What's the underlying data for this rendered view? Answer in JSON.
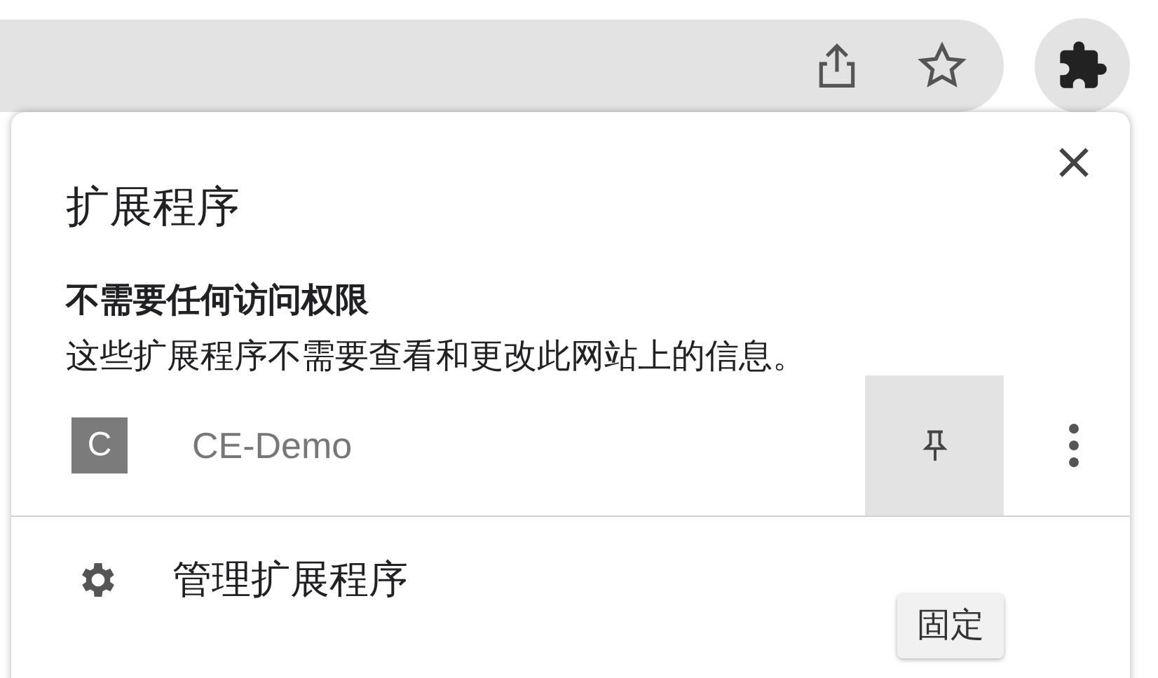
{
  "popup": {
    "title": "扩展程序",
    "section_heading": "不需要任何访问权限",
    "section_description": "这些扩展程序不需要查看和更改此网站上的信息。",
    "extensions": [
      {
        "icon_letter": "C",
        "name": "CE-Demo"
      }
    ],
    "manage_label": "管理扩展程序"
  },
  "tooltip": "固定"
}
